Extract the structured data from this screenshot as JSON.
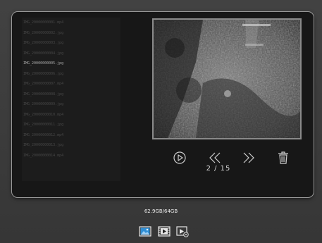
{
  "file_list": {
    "items": [
      "IMG_20000000001.mp4",
      "IMG_20000000002.jpg",
      "IMG_20000000003.jpg",
      "IMG_20000000004.jpg",
      "IMG_20000000005.jpg",
      "IMG_20000000006.jpg",
      "IMG_20000000007.mp4",
      "IMG_20000000008.jpg",
      "IMG_20000000009.jpg",
      "IMG_20000000010.mp4",
      "IMG_20000000011.jpg",
      "IMG_20000000012.mp4",
      "IMG_20000000013.jpg",
      "IMG_20000000014.mp4"
    ],
    "selected_index": 4
  },
  "viewer": {
    "counter": "2 / 15"
  },
  "status": {
    "storage": "62.9GB/64GB"
  },
  "icons": {
    "play": "play-icon",
    "previous": "rewind-icon",
    "next": "fast-forward-icon",
    "delete": "trash-icon",
    "photos": "photo-icon",
    "videos": "video-icon",
    "settings": "photo-settings-icon"
  },
  "colors": {
    "background": "#3a3a3a",
    "panel": "#171717",
    "accent": "#2f8fd6",
    "text": "#d8d8d8"
  }
}
